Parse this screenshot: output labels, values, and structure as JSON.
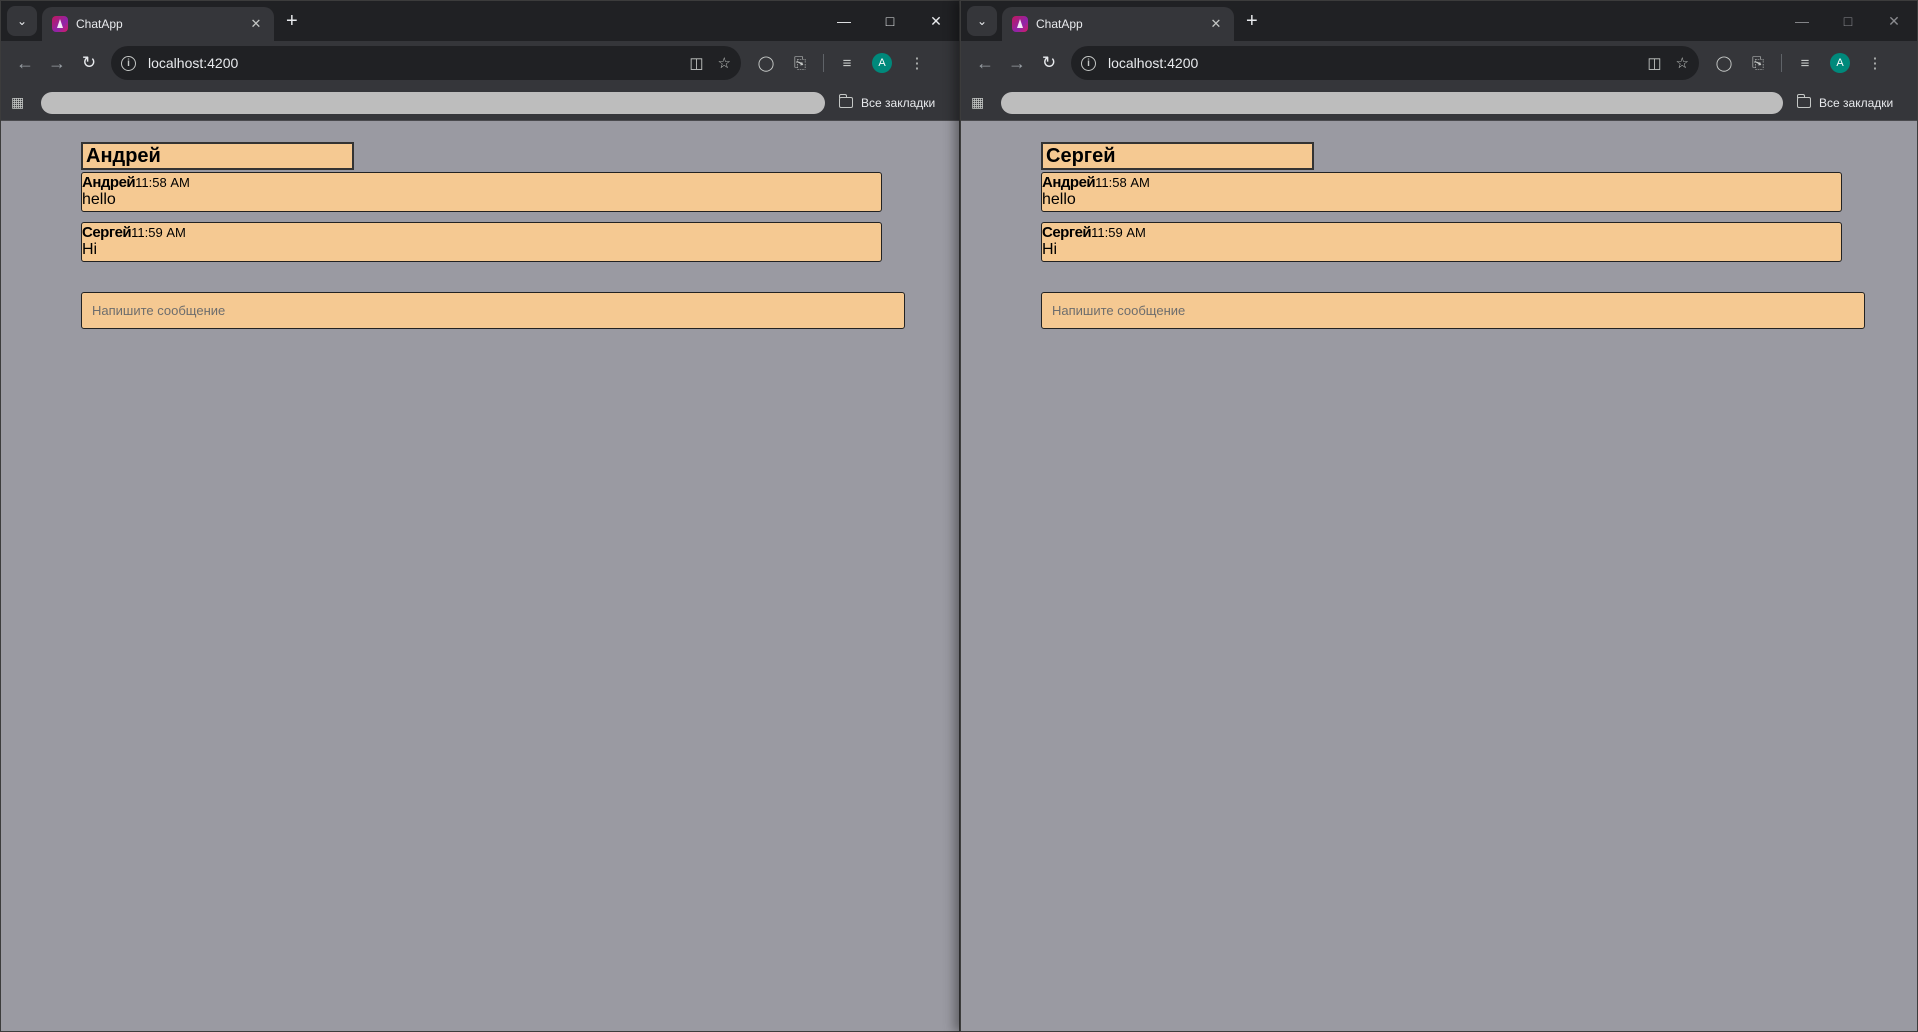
{
  "windows": [
    {
      "tab_title": "ChatApp",
      "url": "localhost:4200",
      "profile_initial": "A",
      "bookmarks_label": "Все закладки",
      "chat": {
        "header": "Андрей",
        "messages": [
          {
            "author": "Андрей",
            "time": "11:58 AM",
            "text": "hello"
          },
          {
            "author": "Сергей",
            "time": "11:59 AM",
            "text": "Hi"
          }
        ],
        "composer_placeholder": "Напишите сообщение"
      }
    },
    {
      "tab_title": "ChatApp",
      "url": "localhost:4200",
      "profile_initial": "A",
      "bookmarks_label": "Все закладки",
      "chat": {
        "header": "Сергей",
        "messages": [
          {
            "author": "Андрей",
            "time": "11:58 AM",
            "text": "hello"
          },
          {
            "author": "Сергей",
            "time": "11:59 AM",
            "text": "Hi"
          }
        ],
        "composer_placeholder": "Напишите сообщение"
      }
    }
  ],
  "icons": {
    "tab_search": "chevron-down-icon",
    "close": "close-icon",
    "new_tab": "plus-icon",
    "back": "arrow-left-icon",
    "forward": "arrow-right-icon",
    "reload": "reload-icon",
    "translate": "translate-icon",
    "bookmark": "star-icon",
    "extensions": "puzzle-icon"
  },
  "colors": {
    "page_background": "#9a9aa2",
    "chat_box": "#f5c992",
    "browser_frame": "#202124",
    "toolbar": "#35363a",
    "avatar": "#00897b"
  }
}
